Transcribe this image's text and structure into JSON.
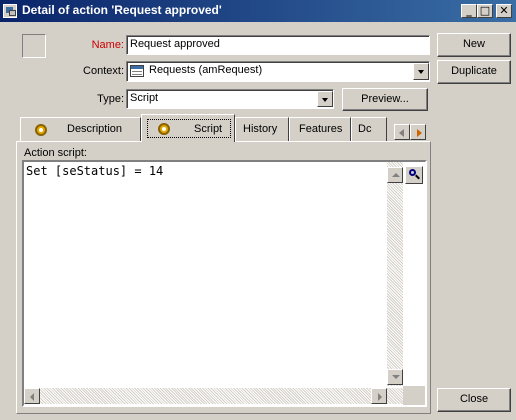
{
  "window": {
    "title": "Detail of action 'Request approved'",
    "title_icon": "action-detail-icon",
    "controls": {
      "minimize": "_",
      "maximize": "□",
      "close": "✕"
    }
  },
  "form": {
    "name_label": "Name:",
    "name_value": "Request approved",
    "name_label_color": "#cc0000",
    "context_label": "Context:",
    "context_value": "Requests (amRequest)",
    "type_label": "Type:",
    "type_value": "Script",
    "preview_label": "Preview..."
  },
  "side_buttons": {
    "new_label": "New",
    "duplicate_label": "Duplicate",
    "close_label": "Close"
  },
  "tabs": [
    {
      "label": "Description",
      "icon": "gear-icon"
    },
    {
      "label": "Script",
      "icon": "script-gear-icon",
      "active": true
    },
    {
      "label": "History"
    },
    {
      "label": "Features"
    },
    {
      "label": "Dc"
    }
  ],
  "script": {
    "label": "Action script:",
    "code": "Set [seStatus] = 14"
  },
  "colors": {
    "titlebar_start": "#0a246a",
    "titlebar_end": "#3a6ea5",
    "window_bg": "#d4d0c8"
  }
}
